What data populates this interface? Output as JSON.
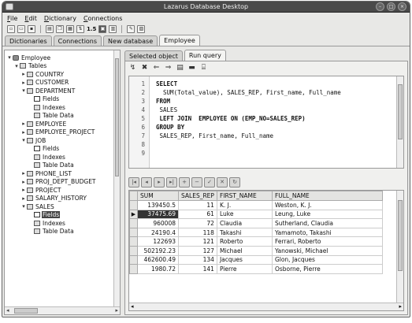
{
  "window": {
    "title": "Lazarus Database Desktop"
  },
  "menu": [
    "File",
    "Edit",
    "Dictionary",
    "Connections"
  ],
  "toolbar": {
    "label_15": "1.5"
  },
  "main_tabs": [
    {
      "label": "Dictionaries",
      "active": false
    },
    {
      "label": "Connections",
      "active": false
    },
    {
      "label": "New database",
      "active": false
    },
    {
      "label": "Employee",
      "active": true
    }
  ],
  "tree": [
    {
      "label": "Employee",
      "depth": 0,
      "expander": "▾",
      "icon": "db"
    },
    {
      "label": "Tables",
      "depth": 1,
      "expander": "▾",
      "icon": "folder"
    },
    {
      "label": "COUNTRY",
      "depth": 2,
      "expander": "▸",
      "icon": "table"
    },
    {
      "label": "CUSTOMER",
      "depth": 2,
      "expander": "▸",
      "icon": "table"
    },
    {
      "label": "DEPARTMENT",
      "depth": 2,
      "expander": "▾",
      "icon": "table"
    },
    {
      "label": "Fields",
      "depth": 3,
      "expander": "",
      "icon": "fields"
    },
    {
      "label": "Indexes",
      "depth": 3,
      "expander": "",
      "icon": "index"
    },
    {
      "label": "Table Data",
      "depth": 3,
      "expander": "",
      "icon": "data"
    },
    {
      "label": "EMPLOYEE",
      "depth": 2,
      "expander": "▸",
      "icon": "table"
    },
    {
      "label": "EMPLOYEE_PROJECT",
      "depth": 2,
      "expander": "▸",
      "icon": "table"
    },
    {
      "label": "JOB",
      "depth": 2,
      "expander": "▾",
      "icon": "table"
    },
    {
      "label": "Fields",
      "depth": 3,
      "expander": "",
      "icon": "fields"
    },
    {
      "label": "Indexes",
      "depth": 3,
      "expander": "",
      "icon": "index"
    },
    {
      "label": "Table Data",
      "depth": 3,
      "expander": "",
      "icon": "data"
    },
    {
      "label": "PHONE_LIST",
      "depth": 2,
      "expander": "▸",
      "icon": "table"
    },
    {
      "label": "PROJ_DEPT_BUDGET",
      "depth": 2,
      "expander": "▸",
      "icon": "table"
    },
    {
      "label": "PROJECT",
      "depth": 2,
      "expander": "▸",
      "icon": "table"
    },
    {
      "label": "SALARY_HISTORY",
      "depth": 2,
      "expander": "▸",
      "icon": "table"
    },
    {
      "label": "SALES",
      "depth": 2,
      "expander": "▾",
      "icon": "table"
    },
    {
      "label": "Fields",
      "depth": 3,
      "expander": "",
      "icon": "fields",
      "selected": true
    },
    {
      "label": "Indexes",
      "depth": 3,
      "expander": "",
      "icon": "index"
    },
    {
      "label": "Table Data",
      "depth": 3,
      "expander": "",
      "icon": "data"
    }
  ],
  "right_tabs": [
    {
      "label": "Selected object",
      "active": false
    },
    {
      "label": "Run query",
      "active": true
    }
  ],
  "sql": [
    {
      "n": "1",
      "text": "SELECT",
      "kw": true,
      "indent": ""
    },
    {
      "n": "2",
      "text": "SUM(Total_value), SALES_REP, First_name, Full_name",
      "kw": false,
      "indent": "  "
    },
    {
      "n": "3",
      "text": "FROM",
      "kw": true,
      "indent": ""
    },
    {
      "n": "4",
      "text": "SALES",
      "kw": false,
      "indent": " "
    },
    {
      "n": "5",
      "text": "LEFT JOIN  EMPLOYEE ON (EMP_NO=SALES_REP)",
      "kw": true,
      "indent": " "
    },
    {
      "n": "6",
      "text": "GROUP BY",
      "kw": true,
      "indent": ""
    },
    {
      "n": "7",
      "text": "SALES_REP, First_name, Full_name",
      "kw": false,
      "indent": " "
    },
    {
      "n": "8",
      "text": "",
      "kw": false,
      "indent": ""
    },
    {
      "n": "9",
      "text": "",
      "kw": false,
      "indent": ""
    }
  ],
  "grid": {
    "columns": [
      "SUM",
      "SALES_REP",
      "FIRST_NAME",
      "FULL_NAME"
    ],
    "rows": [
      [
        "139450.5",
        "11",
        "K. J.",
        "Weston, K. J."
      ],
      [
        "37475.69",
        "61",
        "Luke",
        "Leung, Luke"
      ],
      [
        "960008",
        "72",
        "Claudia",
        "Sutherland, Claudia"
      ],
      [
        "24190.4",
        "118",
        "Takashi",
        "Yamamoto, Takashi"
      ],
      [
        "122693",
        "121",
        "Roberto",
        "Ferrari, Roberto"
      ],
      [
        "502192.23",
        "127",
        "Michael",
        "Yanowski, Michael"
      ],
      [
        "462600.49",
        "134",
        "Jacques",
        "Glon, Jacques"
      ],
      [
        "1980.72",
        "141",
        "Pierre",
        "Osborne, Pierre"
      ]
    ],
    "current_row": 1
  }
}
